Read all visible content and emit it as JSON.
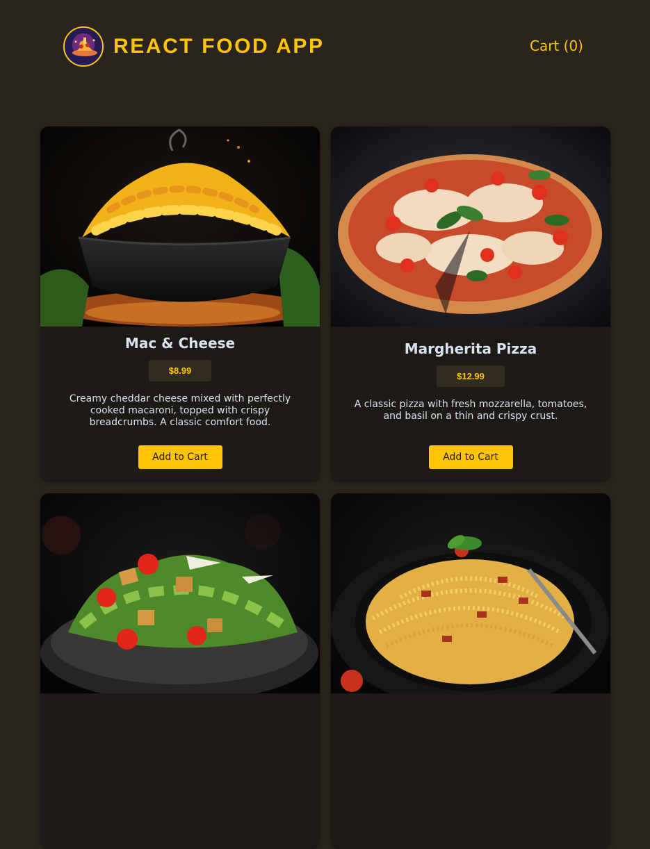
{
  "header": {
    "app_title": "REACT FOOD APP",
    "cart_label": "Cart (0)",
    "logo_icon": "food-logo-icon"
  },
  "colors": {
    "background": "#29251c",
    "accent": "#ffc404",
    "card": "#1d1a16",
    "price_bg": "#312c1d",
    "text": "#d9e2f1"
  },
  "meals": [
    {
      "name": "Mac & Cheese",
      "price": "$8.99",
      "description": "Creamy cheddar cheese mixed with perfectly cooked macaroni, topped with crispy breadcrumbs. A classic comfort food.",
      "button_label": "Add to Cart",
      "image_icon": "mac-and-cheese-photo"
    },
    {
      "name": "Margherita Pizza",
      "price": "$12.99",
      "description": "A classic pizza with fresh mozzarella, tomatoes, and basil on a thin and crispy crust.",
      "button_label": "Add to Cart",
      "image_icon": "margherita-pizza-photo"
    },
    {
      "name": "",
      "price": "",
      "description": "",
      "button_label": "",
      "image_icon": "caesar-salad-photo"
    },
    {
      "name": "",
      "price": "",
      "description": "",
      "button_label": "",
      "image_icon": "spaghetti-carbonara-photo"
    }
  ]
}
